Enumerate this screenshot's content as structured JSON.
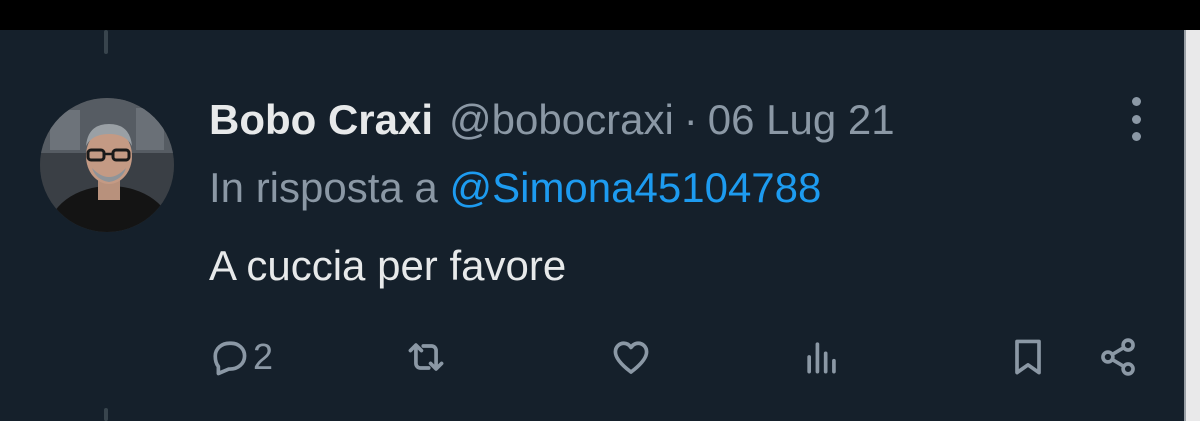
{
  "tweet": {
    "author_name": "Bobo Craxi",
    "handle": "@bobocraxi",
    "separator": "·",
    "date": "06 Lug 21",
    "reply_prefix": "In risposta a",
    "reply_mention": "@Simona45104788",
    "text": "A cuccia per favore"
  },
  "actions": {
    "reply_icon": "speech-bubble-icon",
    "reply_count": "2",
    "retweet_icon": "retweet-icon",
    "like_icon": "heart-icon",
    "views_icon": "bar-chart-icon",
    "bookmark_icon": "bookmark-icon",
    "share_icon": "share-icon"
  },
  "colors": {
    "background": "#15202b",
    "text": "#e7e9ea",
    "secondary": "#8b98a5",
    "accent": "#1d9bf0"
  }
}
